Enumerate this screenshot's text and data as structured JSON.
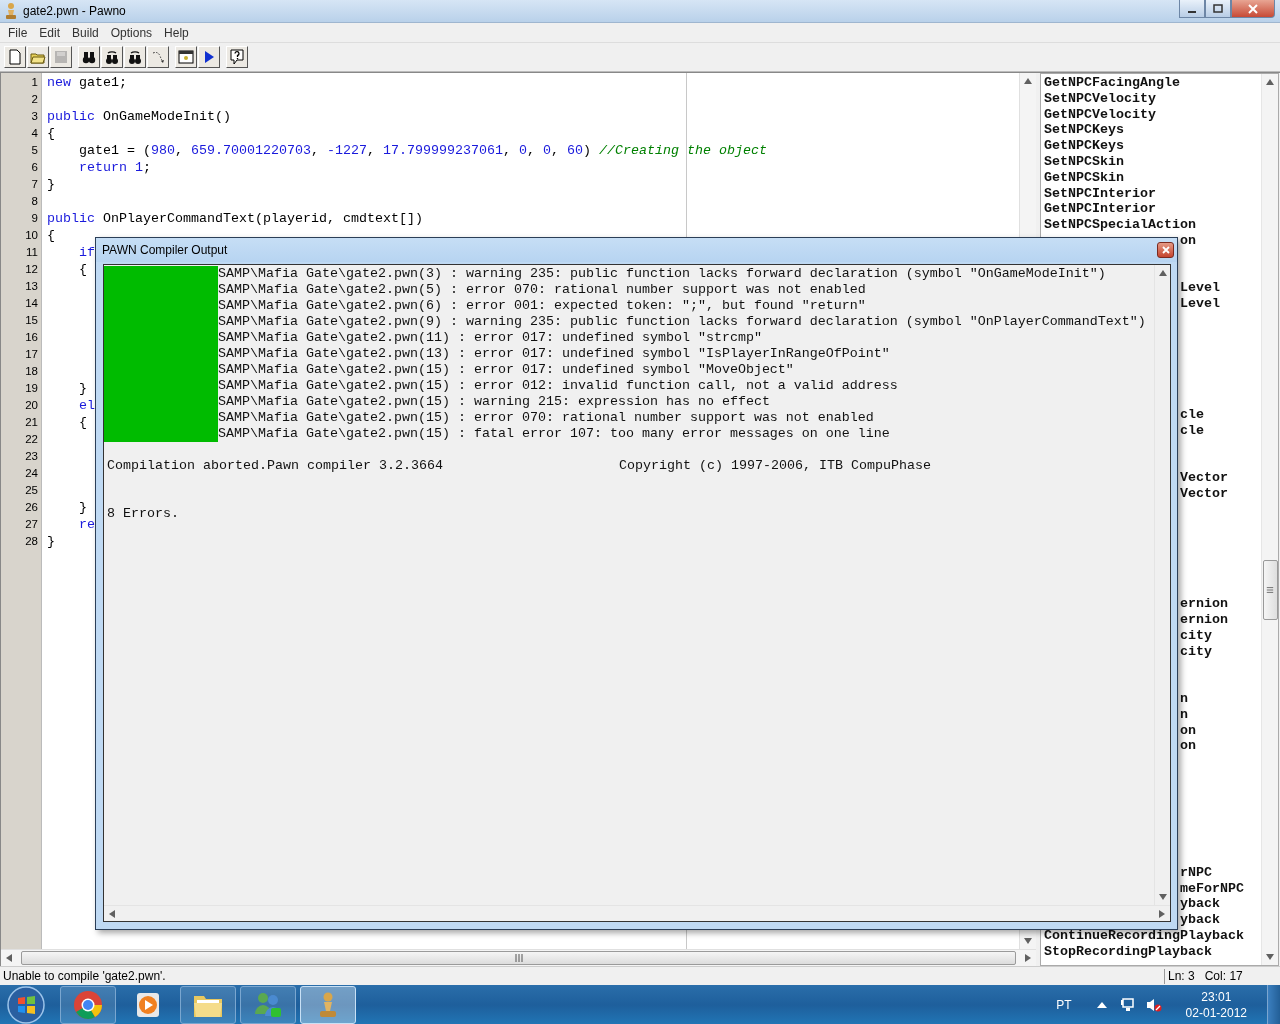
{
  "window": {
    "title": "gate2.pwn - Pawno"
  },
  "menu": [
    "File",
    "Edit",
    "Build",
    "Options",
    "Help"
  ],
  "toolbar": [
    [
      {
        "kind": "new",
        "disabled": false
      },
      {
        "kind": "open",
        "disabled": false
      },
      {
        "kind": "save",
        "disabled": true
      }
    ],
    [
      {
        "kind": "find",
        "disabled": false
      },
      {
        "kind": "find-next",
        "disabled": false
      },
      {
        "kind": "replace",
        "disabled": false
      },
      {
        "kind": "goto",
        "disabled": false
      }
    ],
    [
      {
        "kind": "compile",
        "disabled": false
      },
      {
        "kind": "run",
        "disabled": false
      }
    ],
    [
      {
        "kind": "help",
        "disabled": false
      }
    ]
  ],
  "editor": {
    "lines": [
      {
        "number": "1",
        "parts": [
          {
            "kind": "keyword",
            "text": "new"
          },
          {
            "kind": "plain",
            "text": " gate1;"
          }
        ]
      },
      {
        "number": "2"
      },
      {
        "number": "3",
        "parts": [
          {
            "kind": "keyword",
            "text": "public"
          },
          {
            "kind": "plain",
            "text": " OnGameModeInit()"
          }
        ]
      },
      {
        "number": "4",
        "parts": [
          {
            "kind": "plain",
            "text": "{"
          }
        ]
      },
      {
        "number": "5",
        "indented": true,
        "parts": [
          {
            "kind": "plain",
            "text": "gate1 = ("
          },
          {
            "kind": "number",
            "text": "980"
          },
          {
            "kind": "plain",
            "text": ", "
          },
          {
            "kind": "number",
            "text": "659.70001220703"
          },
          {
            "kind": "plain",
            "text": ", "
          },
          {
            "kind": "number",
            "text": "-1227"
          },
          {
            "kind": "plain",
            "text": ", "
          },
          {
            "kind": "number",
            "text": "17.799999237061"
          },
          {
            "kind": "plain",
            "text": ", "
          },
          {
            "kind": "number",
            "text": "0"
          },
          {
            "kind": "plain",
            "text": ", "
          },
          {
            "kind": "number",
            "text": "0"
          },
          {
            "kind": "plain",
            "text": ", "
          },
          {
            "kind": "number",
            "text": "60"
          },
          {
            "kind": "plain",
            "text": ") "
          },
          {
            "kind": "comment",
            "text": "//Creating the object"
          }
        ]
      },
      {
        "number": "6",
        "indented": true,
        "parts": [
          {
            "kind": "keyword",
            "text": "return"
          },
          {
            "kind": "number",
            "text": " 1"
          },
          {
            "kind": "plain",
            "text": ";"
          }
        ]
      },
      {
        "number": "7",
        "parts": [
          {
            "kind": "plain",
            "text": "}"
          }
        ]
      },
      {
        "number": "8"
      },
      {
        "number": "9",
        "parts": [
          {
            "kind": "keyword",
            "text": "public"
          },
          {
            "kind": "plain",
            "text": " OnPlayerCommandText(playerid, cmdtext[])"
          }
        ]
      },
      {
        "number": "10",
        "parts": [
          {
            "kind": "plain",
            "text": "{"
          }
        ]
      },
      {
        "number": "11",
        "indented": true,
        "parts": [
          {
            "kind": "keyword",
            "text": "if"
          }
        ]
      },
      {
        "number": "12",
        "indented": true,
        "parts": [
          {
            "kind": "plain",
            "text": "{"
          }
        ]
      },
      {
        "number": "13"
      },
      {
        "number": "14"
      },
      {
        "number": "15"
      },
      {
        "number": "16"
      },
      {
        "number": "17"
      },
      {
        "number": "18"
      },
      {
        "number": "19",
        "indented": true,
        "parts": [
          {
            "kind": "plain",
            "text": "}"
          }
        ]
      },
      {
        "number": "20",
        "indented": true,
        "parts": [
          {
            "kind": "keyword",
            "text": "el"
          }
        ]
      },
      {
        "number": "21",
        "indented": true,
        "parts": [
          {
            "kind": "plain",
            "text": "{"
          }
        ]
      },
      {
        "number": "22"
      },
      {
        "number": "23"
      },
      {
        "number": "24"
      },
      {
        "number": "25"
      },
      {
        "number": "26",
        "indented": true,
        "parts": [
          {
            "kind": "plain",
            "text": "}"
          }
        ]
      },
      {
        "number": "27",
        "indented": true,
        "parts": [
          {
            "kind": "keyword",
            "text": "re"
          }
        ]
      },
      {
        "number": "28",
        "parts": [
          {
            "kind": "plain",
            "text": "}"
          }
        ]
      }
    ]
  },
  "functions": [
    {
      "kind": "full",
      "text": "GetNPCFacingAngle"
    },
    {
      "kind": "full",
      "text": "SetNPCVelocity"
    },
    {
      "kind": "full",
      "text": "GetNPCVelocity"
    },
    {
      "kind": "full",
      "text": "SetNPCKeys"
    },
    {
      "kind": "full",
      "text": "GetNPCKeys"
    },
    {
      "kind": "full",
      "text": "SetNPCSkin"
    },
    {
      "kind": "full",
      "text": "GetNPCSkin"
    },
    {
      "kind": "full",
      "text": "SetNPCInterior"
    },
    {
      "kind": "full",
      "text": "GetNPCInterior"
    },
    {
      "kind": "full",
      "text": "SetNPCSpecialAction"
    },
    {
      "kind": "tail",
      "text": "on"
    },
    {
      "kind": "covered"
    },
    {
      "kind": "covered"
    },
    {
      "kind": "tail",
      "text": "Level"
    },
    {
      "kind": "tail",
      "text": "Level"
    },
    {
      "kind": "covered"
    },
    {
      "kind": "covered"
    },
    {
      "kind": "covered"
    },
    {
      "kind": "covered"
    },
    {
      "kind": "covered"
    },
    {
      "kind": "covered"
    },
    {
      "kind": "tail",
      "text": "cle"
    },
    {
      "kind": "tail",
      "text": "cle"
    },
    {
      "kind": "covered"
    },
    {
      "kind": "covered"
    },
    {
      "kind": "tail",
      "text": "Vector"
    },
    {
      "kind": "tail",
      "text": "Vector"
    },
    {
      "kind": "covered"
    },
    {
      "kind": "covered"
    },
    {
      "kind": "covered"
    },
    {
      "kind": "covered"
    },
    {
      "kind": "covered"
    },
    {
      "kind": "covered"
    },
    {
      "kind": "tail",
      "text": "ernion"
    },
    {
      "kind": "tail",
      "text": "ernion"
    },
    {
      "kind": "tail",
      "text": "city"
    },
    {
      "kind": "tail",
      "text": "city"
    },
    {
      "kind": "covered"
    },
    {
      "kind": "covered"
    },
    {
      "kind": "tail",
      "text": "n"
    },
    {
      "kind": "tail",
      "text": "n"
    },
    {
      "kind": "tail",
      "text": "on"
    },
    {
      "kind": "tail",
      "text": "on"
    },
    {
      "kind": "covered"
    },
    {
      "kind": "covered"
    },
    {
      "kind": "covered"
    },
    {
      "kind": "covered"
    },
    {
      "kind": "covered"
    },
    {
      "kind": "covered"
    },
    {
      "kind": "covered"
    },
    {
      "kind": "tail",
      "text": "rNPC"
    },
    {
      "kind": "tail",
      "text": "meForNPC"
    },
    {
      "kind": "tail",
      "text": "yback"
    },
    {
      "kind": "tail",
      "text": "yback"
    },
    {
      "kind": "full",
      "text": "ContinueRecordingPlayback"
    },
    {
      "kind": "full",
      "text": "StopRecordingPlayback"
    }
  ],
  "dialog": {
    "title": "PAWN Compiler Output",
    "messages": [
      "SAMP\\Mafia Gate\\gate2.pwn(3) : warning 235: public function lacks forward declaration (symbol \"OnGameModeInit\")",
      "SAMP\\Mafia Gate\\gate2.pwn(5) : error 070: rational number support was not enabled",
      "SAMP\\Mafia Gate\\gate2.pwn(6) : error 001: expected token: \";\", but found \"return\"",
      "SAMP\\Mafia Gate\\gate2.pwn(9) : warning 235: public function lacks forward declaration (symbol \"OnPlayerCommandText\")",
      "SAMP\\Mafia Gate\\gate2.pwn(11) : error 017: undefined symbol \"strcmp\"",
      "SAMP\\Mafia Gate\\gate2.pwn(13) : error 017: undefined symbol \"IsPlayerInRangeOfPoint\"",
      "SAMP\\Mafia Gate\\gate2.pwn(15) : error 017: undefined symbol \"MoveObject\"",
      "SAMP\\Mafia Gate\\gate2.pwn(15) : error 012: invalid function call, not a valid address",
      "SAMP\\Mafia Gate\\gate2.pwn(15) : warning 215: expression has no effect",
      "SAMP\\Mafia Gate\\gate2.pwn(15) : error 070: rational number support was not enabled",
      "SAMP\\Mafia Gate\\gate2.pwn(15) : fatal error 107: too many error messages on one line"
    ],
    "summary": "Compilation aborted.Pawn compiler 3.2.3664",
    "copyright": "Copyright (c) 1997-2006, ITB CompuPhase",
    "result": "8 Errors."
  },
  "status_bar": {
    "message": "Unable to compile 'gate2.pwn'.",
    "line": "Ln: 3",
    "column": "Col: 17"
  },
  "taskbar": {
    "apps": [
      {
        "kind": "browser",
        "running": true,
        "selected": false
      },
      {
        "kind": "media",
        "running": false,
        "selected": false
      },
      {
        "kind": "folder",
        "running": true,
        "selected": false
      },
      {
        "kind": "messenger",
        "running": true,
        "selected": false
      },
      {
        "kind": "pawn",
        "running": true,
        "selected": true
      }
    ],
    "language": "PT",
    "time": "23:01",
    "date": "02-01-2012"
  }
}
